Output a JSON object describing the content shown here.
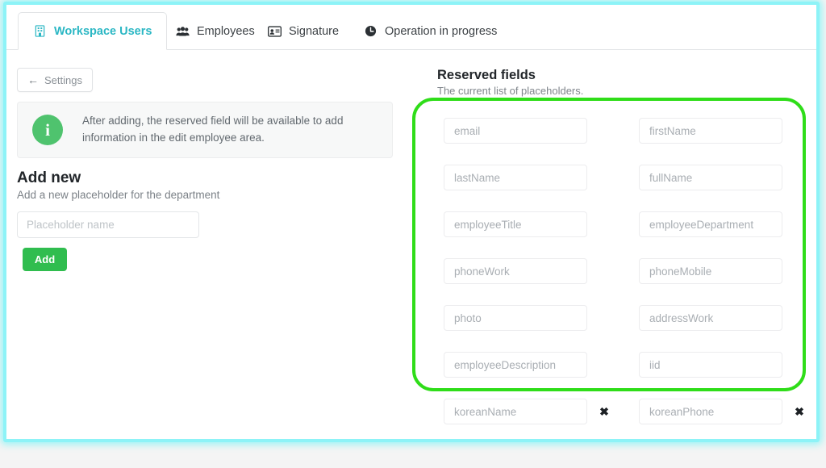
{
  "tabs": [
    {
      "label": "Workspace Users",
      "icon": "building-icon",
      "active": true
    },
    {
      "label": "Employees",
      "icon": "people-group-icon",
      "active": false
    },
    {
      "label": "Signature",
      "icon": "id-card-icon",
      "active": false
    },
    {
      "label": "Operation in progress",
      "icon": "clock-icon",
      "active": false
    }
  ],
  "left": {
    "settings_button": "Settings",
    "back_arrow": "←",
    "info_icon_glyph": "i",
    "info_text": "After adding, the reserved field will be available to add information in the edit employee area.",
    "add_new_title": "Add new",
    "add_new_subtitle": "Add a new placeholder for the department",
    "placeholder_input_value": "",
    "placeholder_input_placeholder": "Placeholder name",
    "add_button": "Add"
  },
  "right": {
    "title": "Reserved fields",
    "subtitle": "The current list of placeholders.",
    "delete_glyph": "✖",
    "rows": [
      {
        "left": {
          "label": "email",
          "deletable": false
        },
        "right": {
          "label": "firstName",
          "deletable": false
        }
      },
      {
        "left": {
          "label": "lastName",
          "deletable": false
        },
        "right": {
          "label": "fullName",
          "deletable": false
        }
      },
      {
        "left": {
          "label": "employeeTitle",
          "deletable": false
        },
        "right": {
          "label": "employeeDepartment",
          "deletable": false
        }
      },
      {
        "left": {
          "label": "phoneWork",
          "deletable": false
        },
        "right": {
          "label": "phoneMobile",
          "deletable": false
        }
      },
      {
        "left": {
          "label": "photo",
          "deletable": false
        },
        "right": {
          "label": "addressWork",
          "deletable": false
        }
      },
      {
        "left": {
          "label": "employeeDescription",
          "deletable": false
        },
        "right": {
          "label": "iid",
          "deletable": false
        }
      },
      {
        "left": {
          "label": "koreanName",
          "deletable": true
        },
        "right": {
          "label": "koreanPhone",
          "deletable": true
        }
      }
    ]
  },
  "colors": {
    "accent_teal": "#2bb7c4",
    "green_button": "#30bd4f",
    "info_green": "#4fc36e",
    "highlight_green": "#2fdd19",
    "window_glow_cyan": "#8df3f7"
  }
}
